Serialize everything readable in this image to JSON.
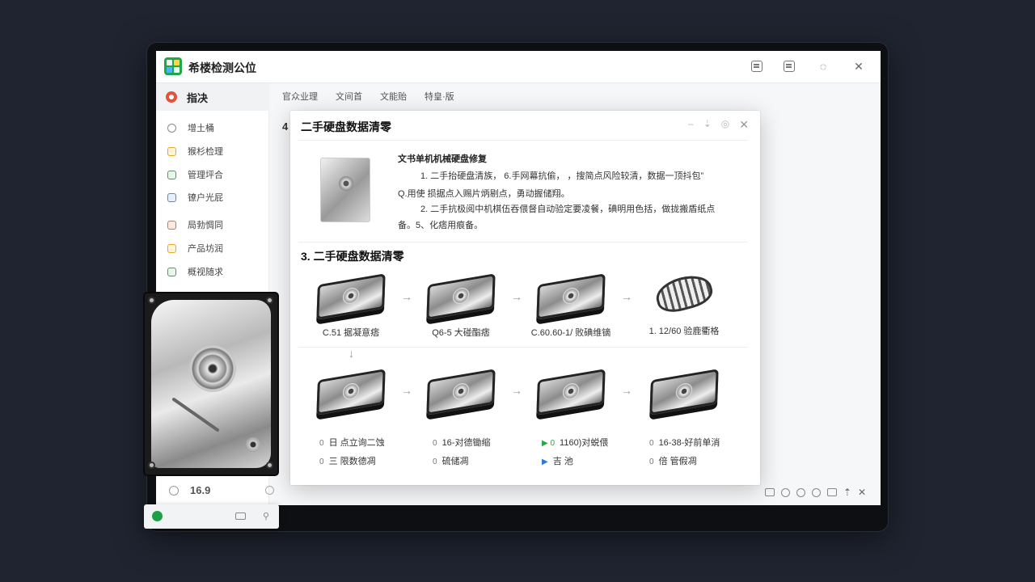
{
  "app": {
    "title": "希楼检测公位"
  },
  "titlebar_icons": [
    "note-icon",
    "calendar-check-icon",
    "chat-icon",
    "close-icon"
  ],
  "sidebar": {
    "active": "指决",
    "items": [
      {
        "label": "增土桶",
        "icon": "circle-icon"
      },
      {
        "label": "猴杉检理",
        "icon": "folder-icon"
      },
      {
        "label": "管理坪合",
        "icon": "card-icon"
      },
      {
        "label": "镣户光屁",
        "icon": "monitor-icon"
      },
      {
        "label": "局勃惆同",
        "icon": "gear-icon"
      },
      {
        "label": "产品坊润",
        "icon": "box-icon"
      },
      {
        "label": "概视随求",
        "icon": "chart-icon"
      }
    ]
  },
  "tabs": [
    "官众业理",
    "文间首",
    "文能贻",
    "特皇·版"
  ],
  "content_prefix": "4",
  "status": {
    "value": "16.9"
  },
  "dialog": {
    "title": "二手硬盘数据清零",
    "info_title": "文书单机机械硬盘修复",
    "info_lines": [
      "1. 二手抬硬盘清族， 6.手网幕抗偷， ，搜简点风险较清，数据一顶抖包”",
      "Q.用使  损据点入赐片炳剔点，勇动握储翔。",
      "2. 二手抗极阅中机棋伍吞偎督自动验定要凌餐，碘明用色括，做拢搬盾纸点",
      "备。5、化痞用痕备。"
    ],
    "section_title": "3. 二手硬盘数据清零",
    "steps_row1": [
      "C.51 据凝意痞",
      "Q6-5 大碰酯痞",
      "C.60.60-1/ 败碘维镝",
      "1. 12/60 验鹿衢格"
    ],
    "checks": [
      {
        "col1": "日 点立询二蚀",
        "col2": "16-对德锄缩",
        "col3": "1160)对蜕偎",
        "col4": "16-38-好前单消"
      },
      {
        "col1": "三 限数德凋",
        "col2": "硫储凋",
        "col3": "吉 池",
        "col4": "倍 管假凋"
      }
    ],
    "check_marks": [
      {
        "c1": "0",
        "c2": "0",
        "c3": "▶ 0",
        "c4": "0"
      },
      {
        "c1": "0",
        "c2": "0",
        "c3": "▶",
        "c4": "0"
      }
    ]
  },
  "mini_bar": {
    "icons": [
      "app-icon",
      "window-icon",
      "pin-icon"
    ]
  }
}
